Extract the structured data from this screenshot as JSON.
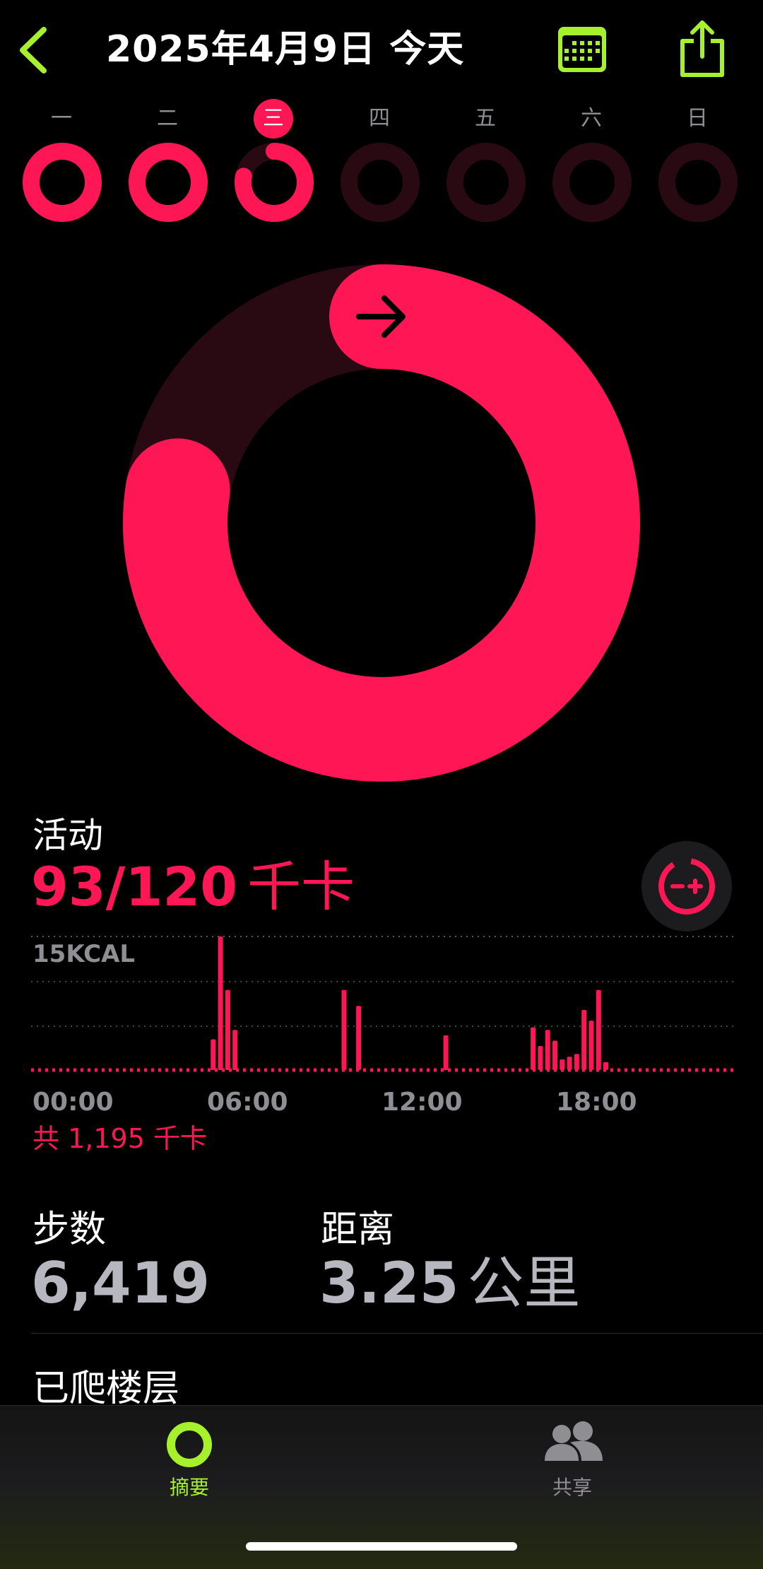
{
  "header": {
    "date_title": "2025年4月9日 今天",
    "back_icon": "chevron-left-icon",
    "calendar_icon": "calendar-icon",
    "share_icon": "share-icon",
    "accent_color": "#A6F02C"
  },
  "week": {
    "days": [
      {
        "label": "一",
        "progress": 1.0,
        "today": false
      },
      {
        "label": "二",
        "progress": 1.0,
        "today": false
      },
      {
        "label": "三",
        "progress": 0.78,
        "today": true
      },
      {
        "label": "四",
        "progress": 0,
        "today": false
      },
      {
        "label": "五",
        "progress": 0,
        "today": false
      },
      {
        "label": "六",
        "progress": 0,
        "today": false
      },
      {
        "label": "日",
        "progress": 0,
        "today": false
      }
    ]
  },
  "ring": {
    "progress": 0.775,
    "color": "#FF1654",
    "track_color": "#2A0A12",
    "arrow_icon": "arrow-right-icon"
  },
  "activity": {
    "title": "活动",
    "value": "93/120",
    "unit": "千卡",
    "goal_icon": "adjust-goal-icon"
  },
  "chart_data": {
    "type": "bar",
    "scale_label": "15KCAL",
    "x_ticks": [
      "00:00",
      "06:00",
      "12:00",
      "18:00"
    ],
    "hours_per_bar": 0.25,
    "bar_hours": [
      6.25,
      6.5,
      6.75,
      7.0,
      10.75,
      11.25,
      14.25,
      17.25,
      17.5,
      17.75,
      18.0,
      18.25,
      18.5,
      18.75,
      19.0,
      19.25,
      19.5,
      19.75
    ],
    "bar_values": [
      2.3,
      10.0,
      6.0,
      3.0,
      6.0,
      4.8,
      2.6,
      3.2,
      1.8,
      3.0,
      2.2,
      0.8,
      1.0,
      1.2,
      4.5,
      3.7,
      6.0,
      0.6
    ],
    "max_value": 10.0,
    "total_label": "共 1,195 千卡",
    "color": "#FF1654"
  },
  "stats": {
    "steps_label": "步数",
    "steps_value": "6,419",
    "distance_label": "距离",
    "distance_value": "3.25",
    "distance_unit": "公里",
    "floors_label": "已爬楼层"
  },
  "tabbar": {
    "summary_label": "摘要",
    "summary_icon": "activity-ring-icon",
    "sharing_label": "共享",
    "sharing_icon": "people-icon"
  }
}
